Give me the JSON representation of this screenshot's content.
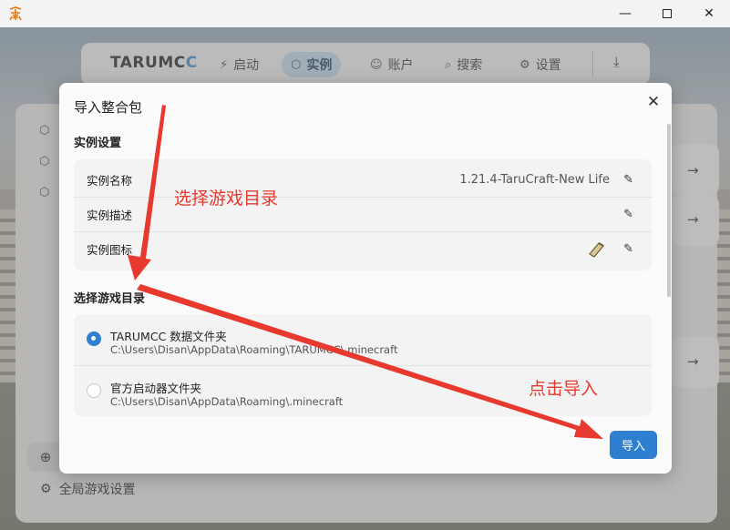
{
  "window": {
    "min_glyph": "—",
    "close_glyph": "✕"
  },
  "navbar": {
    "brand_main": "TARUMC",
    "brand_accent": "C",
    "items": [
      {
        "icon": "⚡",
        "label": "启动"
      },
      {
        "icon": "⬡",
        "label": "实例"
      },
      {
        "icon": "☺",
        "label": "账户"
      },
      {
        "icon": "⌕",
        "label": "搜索"
      },
      {
        "icon": "⚙",
        "label": "设置"
      }
    ],
    "download_glyph": "⤓"
  },
  "sidebar": {
    "global_settings_label": "全局游戏设置"
  },
  "dialog": {
    "title": "导入整合包",
    "close_glyph": "✕",
    "instance_section": "实例设置",
    "rows": [
      {
        "label": "实例名称",
        "value": "1.21.4-TaruCraft-New Life"
      },
      {
        "label": "实例描述",
        "value": ""
      },
      {
        "label": "实例图标",
        "value": ""
      }
    ],
    "edit_glyph": "✎",
    "dir_section": "选择游戏目录",
    "dir_options": [
      {
        "title": "TARUMCC 数据文件夹",
        "path": "C:\\Users\\Disan\\AppData\\Roaming\\TARUMCC\\.minecraft",
        "checked": true
      },
      {
        "title": "官方启动器文件夹",
        "path": "C:\\Users\\Disan\\AppData\\Roaming\\.minecraft",
        "checked": false
      }
    ],
    "import_label": "导入"
  },
  "annotations": {
    "choose_dir": "选择游戏目录",
    "click_import": "点击导入",
    "arrow_color": "#e8392f"
  },
  "colors": {
    "accent": "#2f7fd1",
    "nav_active": "#bcd3e6"
  }
}
